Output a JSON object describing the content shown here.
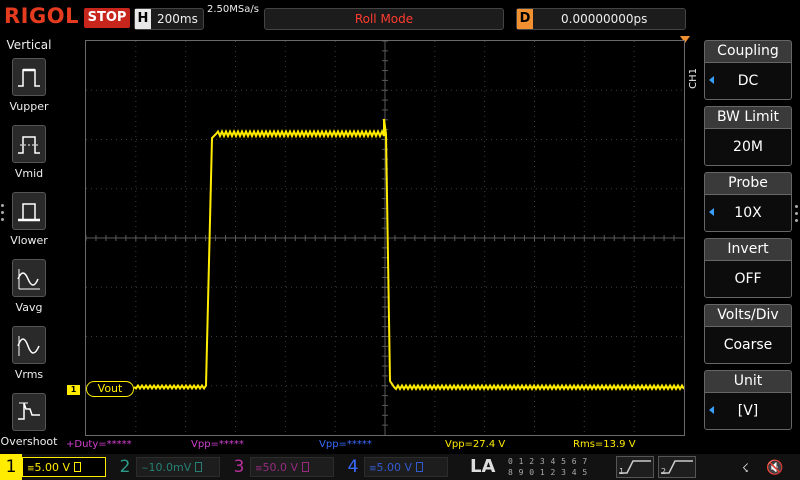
{
  "header": {
    "brand": "RIGOL",
    "run_state": "STOP",
    "timebase_letter": "H",
    "timebase": "200ms",
    "sample_rate": "2.50MSa/s",
    "mode": "Roll Mode",
    "delay_letter": "D",
    "delay": "0.00000000ps"
  },
  "measure_panel": {
    "title": "Vertical",
    "items": [
      {
        "label": "Vupper",
        "icon": "vupper-icon"
      },
      {
        "label": "Vmid",
        "icon": "vmid-icon"
      },
      {
        "label": "Vlower",
        "icon": "vlower-icon"
      },
      {
        "label": "Vavg",
        "icon": "vavg-icon"
      },
      {
        "label": "Vrms",
        "icon": "vrms-icon"
      },
      {
        "label": "Overshoot",
        "icon": "overshoot-icon"
      }
    ]
  },
  "channel_menu": {
    "tab": "CH1",
    "items": [
      {
        "label": "Coupling",
        "value": "DC",
        "has_arrow": true
      },
      {
        "label": "BW Limit",
        "value": "20M",
        "has_arrow": false
      },
      {
        "label": "Probe",
        "value": "10X",
        "has_arrow": true
      },
      {
        "label": "Invert",
        "value": "OFF",
        "has_arrow": false
      },
      {
        "label": "Volts/Div",
        "value": "Coarse",
        "has_arrow": false
      },
      {
        "label": "Unit",
        "value": "[V]",
        "has_arrow": true
      }
    ]
  },
  "trace": {
    "channel_marker": "1",
    "label": "Vout",
    "color": "#ffec00"
  },
  "measurements": [
    {
      "text": "+Duty=*****",
      "color": "#d040d0"
    },
    {
      "text": "Vpp=*****",
      "color": "#d040d0"
    },
    {
      "text": "Vpp=*****",
      "color": "#3a6cff"
    },
    {
      "text": "Vpp=27.4 V",
      "color": "#ffec00"
    },
    {
      "text": "Rms=13.9 V",
      "color": "#ffec00"
    }
  ],
  "channels": [
    {
      "num": "1",
      "scale": "5.00 V",
      "color": "#ffec00",
      "active": true
    },
    {
      "num": "2",
      "scale": "10.0mV",
      "color": "#2a9c8c",
      "active": false
    },
    {
      "num": "3",
      "scale": "50.0 V",
      "color": "#b8309c",
      "active": false
    },
    {
      "num": "4",
      "scale": "5.00 V",
      "color": "#3a6cff",
      "active": false
    }
  ],
  "la": {
    "label": "LA",
    "row1": "0 1 2 3  4 5 6 7",
    "row2": "8 9 0 1  2 3 4 5"
  },
  "decoders": [
    {
      "num": "1"
    },
    {
      "num": "2"
    }
  ],
  "status_icons": {
    "usb": "usb-icon",
    "sound": "speaker-mute-icon"
  },
  "colors": {
    "brand": "#e53b1f",
    "stop": "#c8261c",
    "trigger": "#f09030",
    "ch1": "#ffec00",
    "menu_arrow": "#3aa0ff"
  }
}
